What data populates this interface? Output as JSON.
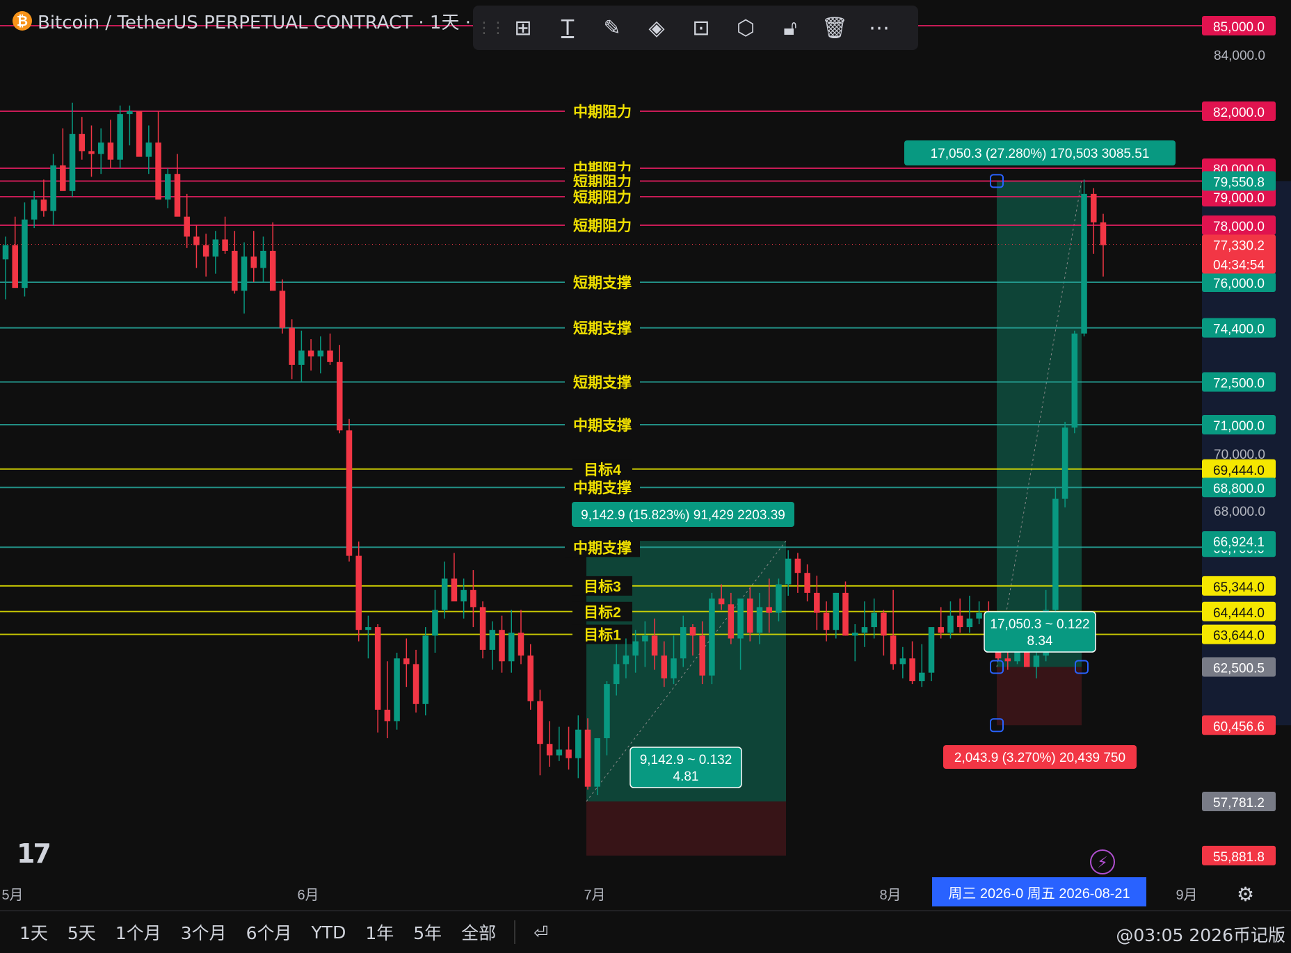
{
  "header": {
    "symbol_icon": "₿",
    "title": "Bitcoin / TetherUS PERPETUAL CONTRACT · 1天 · B"
  },
  "toolbar": {
    "icons": [
      "grip-icon",
      "templates-icon",
      "text-icon",
      "line-color-icon",
      "fill-color-icon",
      "add-alert-icon",
      "settings-icon",
      "unlock-icon",
      "trash-icon",
      "more-icon"
    ]
  },
  "chart_data": {
    "type": "candlestick",
    "symbol": "BTCUSDT.P",
    "price_axis": {
      "min": 55000,
      "max": 86000,
      "ticks": [
        "84,000.0",
        "70,000.0",
        "68,000.0"
      ]
    },
    "time_axis": {
      "labels": [
        {
          "text": "5月"
        },
        {
          "text": "6月"
        },
        {
          "text": "7月"
        },
        {
          "text": "8月"
        },
        {
          "text": "9月"
        }
      ]
    },
    "horizontal_levels": [
      {
        "label": "",
        "price": 85000,
        "tag": "85,000.0",
        "color": "#e91e63"
      },
      {
        "label": "中期阻力",
        "price": 82000,
        "tag": "82,000.0",
        "color": "#e91e63"
      },
      {
        "label": "中期阻力",
        "price": 80000,
        "tag": "80,000.0",
        "color": "#e91e63"
      },
      {
        "label": "短期阻力",
        "price": 79550,
        "tag": "79,550.0",
        "color": "#e91e63"
      },
      {
        "label": "短期阻力",
        "price": 79000,
        "tag": "79,000.0",
        "color": "#e91e63"
      },
      {
        "label": "短期阻力",
        "price": 78000,
        "tag": "78,000.0",
        "color": "#e91e63"
      },
      {
        "label": "短期支撑",
        "price": 76000,
        "tag": "76,000.0",
        "color": "#26a69a"
      },
      {
        "label": "短期支撑",
        "price": 74400,
        "tag": "74,400.0",
        "color": "#26a69a"
      },
      {
        "label": "短期支撑",
        "price": 72500,
        "tag": "72,500.0",
        "color": "#26a69a"
      },
      {
        "label": "中期支撑",
        "price": 71000,
        "tag": "71,000.0",
        "color": "#26a69a"
      },
      {
        "label": "目标4",
        "price": 69444,
        "tag": "69,444.0",
        "color": "#e6e600"
      },
      {
        "label": "中期支撑",
        "price": 68800,
        "tag": "68,800.0",
        "color": "#26a69a"
      },
      {
        "label": "中期支撑",
        "price": 66700,
        "tag": "66,700.0",
        "color": "#26a69a"
      },
      {
        "label": "目标3",
        "price": 65344,
        "tag": "65,344.0",
        "color": "#e6e600"
      },
      {
        "label": "目标2",
        "price": 64444,
        "tag": "64,444.0",
        "color": "#e6e600"
      },
      {
        "label": "目标1",
        "price": 63644,
        "tag": "63,644.0",
        "color": "#e6e600"
      }
    ],
    "price_tags": [
      {
        "price": 79550.8,
        "text": "79,550.8",
        "color": "#089981"
      },
      {
        "price": 77330.2,
        "text": "77,330.2",
        "color": "#f23645",
        "sub": "04:34:54"
      },
      {
        "price": 66924.1,
        "text": "66,924.1",
        "color": "#089981"
      },
      {
        "price": 62500.5,
        "text": "62,500.5",
        "color": "#787b86"
      },
      {
        "price": 60456.6,
        "text": "60,456.6",
        "color": "#f23645"
      },
      {
        "price": 57781.2,
        "text": "57,781.2",
        "color": "#787b86"
      },
      {
        "price": 55881.8,
        "text": "55,881.8",
        "color": "#f23645"
      }
    ],
    "positions": [
      {
        "entry": 57781.2,
        "target": 66924.1,
        "stop": 55881.8,
        "target_label": "9,142.9 (15.823%) 91,429 2203.39",
        "mid_label_1": "9,142.9 ~ 0.132",
        "mid_label_2": "4.81"
      },
      {
        "entry": 62500.5,
        "target": 79550.8,
        "stop": 60456.6,
        "target_label": "17,050.3 (27.280%) 170,503 3085.51",
        "mid_label_1": "17,050.3 ~ 0.122",
        "mid_label_2": "8.34",
        "stop_label": "2,043.9 (3.270%) 20,439 750"
      }
    ],
    "date_range_label": "周三 2026-0   周五 2026-08-21",
    "candles": [
      [
        76800,
        77600,
        75400,
        77300
      ],
      [
        77300,
        78300,
        75900,
        75800
      ],
      [
        75800,
        78800,
        75500,
        78200
      ],
      [
        78200,
        79200,
        77900,
        78900
      ],
      [
        78900,
        79600,
        78300,
        78500
      ],
      [
        78500,
        80500,
        78000,
        80100
      ],
      [
        80100,
        81400,
        79800,
        79200
      ],
      [
        79200,
        82300,
        79000,
        81200
      ],
      [
        81200,
        81800,
        80300,
        80600
      ],
      [
        80600,
        81500,
        79700,
        80500
      ],
      [
        80500,
        81400,
        79800,
        80900
      ],
      [
        80900,
        81700,
        80000,
        80300
      ],
      [
        80300,
        82200,
        80000,
        81900
      ],
      [
        81900,
        82200,
        80800,
        82000
      ],
      [
        82000,
        81900,
        80800,
        80400
      ],
      [
        80400,
        81500,
        79800,
        80900
      ],
      [
        80900,
        82000,
        79700,
        78900
      ],
      [
        78900,
        80000,
        78600,
        79800
      ],
      [
        79800,
        80500,
        78500,
        78300
      ],
      [
        78300,
        79100,
        77200,
        77600
      ],
      [
        77600,
        78000,
        76500,
        77300
      ],
      [
        77300,
        77700,
        76200,
        76900
      ],
      [
        76900,
        77800,
        76300,
        77500
      ],
      [
        77500,
        78300,
        77000,
        77100
      ],
      [
        77100,
        77800,
        75600,
        75700
      ],
      [
        75700,
        77400,
        74900,
        76900
      ],
      [
        76900,
        77800,
        76000,
        76500
      ],
      [
        76500,
        77600,
        76000,
        77100
      ],
      [
        77100,
        78100,
        75800,
        75700
      ],
      [
        75700,
        76100,
        74200,
        74400
      ],
      [
        74400,
        74700,
        72600,
        73100
      ],
      [
        73100,
        74300,
        72500,
        73600
      ],
      [
        73600,
        74000,
        72900,
        73400
      ],
      [
        73400,
        74100,
        72800,
        73600
      ],
      [
        73600,
        74200,
        73100,
        73200
      ],
      [
        73200,
        73800,
        70700,
        70800
      ],
      [
        70800,
        71200,
        66200,
        66400
      ],
      [
        66400,
        66900,
        63400,
        63800
      ],
      [
        63800,
        64300,
        62800,
        63900
      ],
      [
        63900,
        64000,
        60200,
        61000
      ],
      [
        61000,
        62700,
        60000,
        60600
      ],
      [
        60600,
        63000,
        60300,
        62800
      ],
      [
        62800,
        63500,
        61800,
        62600
      ],
      [
        62600,
        63100,
        60900,
        61200
      ],
      [
        61200,
        63900,
        60800,
        63600
      ],
      [
        63600,
        65200,
        63000,
        64500
      ],
      [
        64500,
        66200,
        64200,
        65600
      ],
      [
        65600,
        66500,
        64900,
        64800
      ],
      [
        64800,
        65600,
        64200,
        65200
      ],
      [
        65200,
        65900,
        63900,
        64600
      ],
      [
        64600,
        64800,
        62800,
        63100
      ],
      [
        63100,
        64100,
        62400,
        63800
      ],
      [
        63800,
        64300,
        62300,
        62700
      ],
      [
        62700,
        64500,
        62300,
        63700
      ],
      [
        63700,
        64500,
        62600,
        62900
      ],
      [
        62900,
        63300,
        61000,
        61300
      ],
      [
        61300,
        61700,
        58700,
        59800
      ],
      [
        59800,
        60600,
        59000,
        59400
      ],
      [
        59400,
        60400,
        59200,
        59600
      ],
      [
        59600,
        60400,
        58900,
        59300
      ],
      [
        59300,
        60800,
        58600,
        60300
      ],
      [
        60300,
        60700,
        58200,
        58300
      ],
      [
        58300,
        60000,
        58000,
        60000
      ],
      [
        60000,
        62000,
        59400,
        61900
      ],
      [
        61900,
        63300,
        61500,
        62600
      ],
      [
        62600,
        63500,
        62100,
        62900
      ],
      [
        62900,
        63800,
        62300,
        63400
      ],
      [
        63400,
        64100,
        62500,
        63600
      ],
      [
        63600,
        64200,
        62400,
        62900
      ],
      [
        62900,
        63400,
        61800,
        62100
      ],
      [
        62100,
        63600,
        61900,
        62800
      ],
      [
        62800,
        64300,
        62500,
        63900
      ],
      [
        63900,
        64000,
        62900,
        63600
      ],
      [
        63600,
        64100,
        61900,
        62200
      ],
      [
        62200,
        65100,
        61900,
        64900
      ],
      [
        64900,
        65400,
        64500,
        64700
      ],
      [
        64700,
        65100,
        63300,
        63500
      ],
      [
        63500,
        64800,
        62400,
        64900
      ],
      [
        64900,
        65300,
        63400,
        63700
      ],
      [
        63700,
        65100,
        63300,
        64600
      ],
      [
        64600,
        65600,
        63700,
        64400
      ],
      [
        64400,
        65600,
        64100,
        65400
      ],
      [
        65400,
        66600,
        65000,
        66300
      ],
      [
        66300,
        66500,
        65100,
        65800
      ],
      [
        65800,
        66100,
        64800,
        65100
      ],
      [
        65100,
        65700,
        63800,
        64400
      ],
      [
        64400,
        64800,
        63400,
        63800
      ],
      [
        63800,
        65100,
        63500,
        65100
      ],
      [
        65100,
        65500,
        63600,
        63600
      ],
      [
        63600,
        64000,
        62700,
        63700
      ],
      [
        63700,
        64800,
        63200,
        63900
      ],
      [
        63900,
        64900,
        63500,
        64400
      ],
      [
        64400,
        64500,
        62900,
        63600
      ],
      [
        63600,
        65200,
        62400,
        62600
      ],
      [
        62600,
        63200,
        62100,
        62800
      ],
      [
        62800,
        63400,
        61900,
        62000
      ],
      [
        62000,
        63300,
        61800,
        62300
      ],
      [
        62300,
        63800,
        62000,
        63900
      ],
      [
        63900,
        64600,
        63500,
        63700
      ],
      [
        63700,
        64800,
        63500,
        64300
      ],
      [
        64300,
        64900,
        63700,
        63900
      ],
      [
        63900,
        65000,
        63700,
        64200
      ],
      [
        64200,
        64800,
        64000,
        64400
      ],
      [
        64400,
        64800,
        63700,
        63900
      ],
      [
        63900,
        64200,
        62700,
        62800
      ],
      [
        62800,
        63400,
        62400,
        62700
      ],
      [
        62700,
        63600,
        62600,
        63200
      ],
      [
        63200,
        63900,
        62500,
        62500
      ],
      [
        62500,
        63100,
        62100,
        62900
      ],
      [
        62900,
        65200,
        62700,
        64500
      ],
      [
        64500,
        68800,
        64400,
        68400
      ],
      [
        68400,
        71100,
        68100,
        70900
      ],
      [
        70900,
        74300,
        70700,
        74200
      ],
      [
        74200,
        79600,
        74100,
        79100
      ],
      [
        79100,
        79300,
        77000,
        78100
      ],
      [
        78100,
        78400,
        76200,
        77300
      ]
    ]
  },
  "bottom_bar": {
    "periods": [
      "1天",
      "5天",
      "1个月",
      "3个月",
      "6个月",
      "YTD",
      "1年",
      "5年",
      "全部"
    ],
    "replay_icon": "replay-icon",
    "watermark": "@03:05 2026币记版"
  }
}
